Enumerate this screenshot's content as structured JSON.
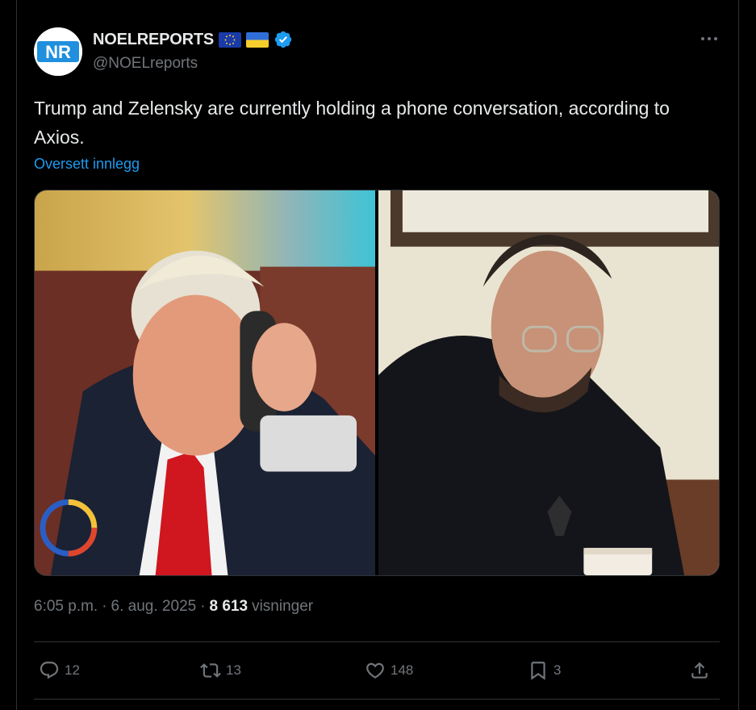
{
  "author": {
    "display_name": "NOELREPORTS",
    "handle": "@NOELreports",
    "avatar_text": "NR",
    "badges": [
      "eu-flag-icon",
      "ukraine-flag-icon",
      "verified-badge-icon"
    ]
  },
  "tweet": {
    "text": "Trump and Zelensky are currently holding a phone conversation, according to Axios.",
    "translate_label": "Oversett innlegg",
    "time": "6:05 p.m.",
    "date": "6. aug. 2025",
    "separator": "·",
    "views_count": "8 613",
    "views_label": "visninger"
  },
  "media": [
    {
      "icon": "photo-trump-on-phone"
    },
    {
      "icon": "photo-zelensky-on-phone"
    }
  ],
  "actions": {
    "replies": "12",
    "reposts": "13",
    "likes": "148",
    "bookmarks": "3"
  },
  "colors": {
    "background": "#000000",
    "text": "#e7e9ea",
    "secondary": "#71767b",
    "link": "#1d9bf0",
    "border": "#2f3336"
  }
}
